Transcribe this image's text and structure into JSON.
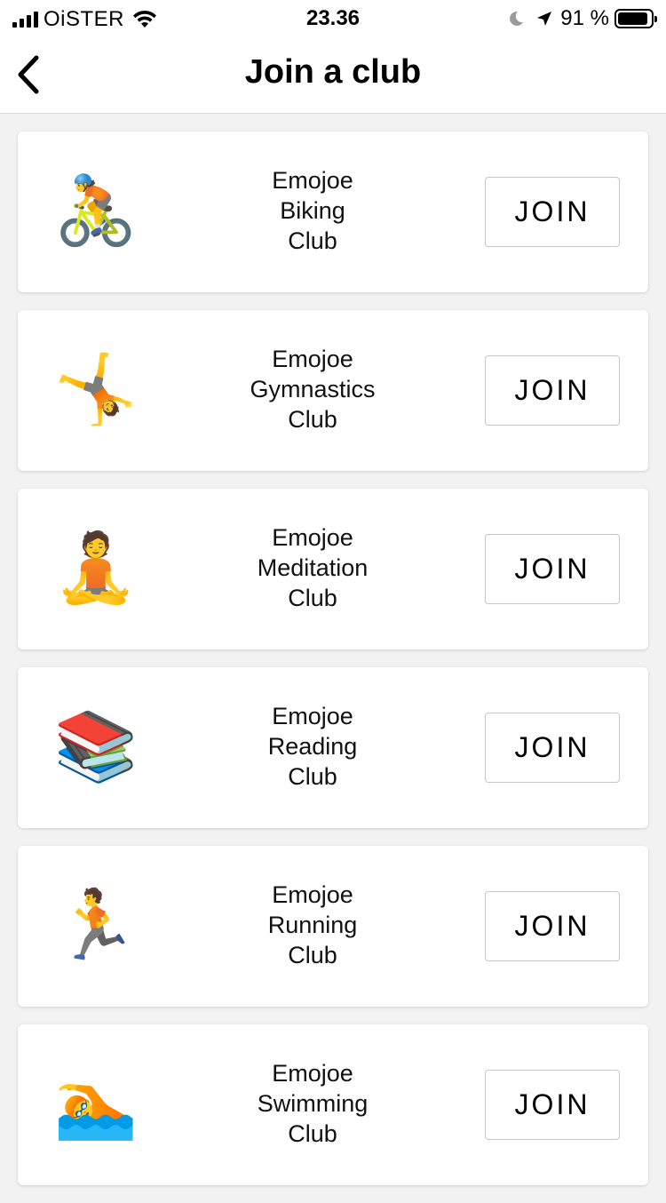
{
  "status_bar": {
    "carrier": "OiSTER",
    "time": "23.36",
    "battery_percent": "91 %",
    "battery_level": 0.91,
    "icons": [
      "signal-icon",
      "wifi-icon",
      "moon-icon",
      "location-arrow-icon",
      "battery-icon"
    ]
  },
  "nav": {
    "title": "Join a club",
    "back_icon": "chevron-left-icon"
  },
  "clubs": [
    {
      "emoji": "🚴",
      "icon_name": "biking-icon",
      "name": "Emojoe\nBiking\nClub",
      "button": "JOIN"
    },
    {
      "emoji": "🤸",
      "icon_name": "gymnastics-icon",
      "name": "Emojoe\nGymnastics\nClub",
      "button": "JOIN"
    },
    {
      "emoji": "🧘",
      "icon_name": "meditation-icon",
      "name": "Emojoe\nMeditation\nClub",
      "button": "JOIN"
    },
    {
      "emoji": "📚",
      "icon_name": "books-icon",
      "name": "Emojoe\nReading\nClub",
      "button": "JOIN"
    },
    {
      "emoji": "🏃",
      "icon_name": "running-icon",
      "name": "Emojoe\nRunning\nClub",
      "button": "JOIN"
    },
    {
      "emoji": "🏊",
      "icon_name": "swimming-icon",
      "name": "Emojoe\nSwimming\nClub",
      "button": "JOIN"
    }
  ]
}
